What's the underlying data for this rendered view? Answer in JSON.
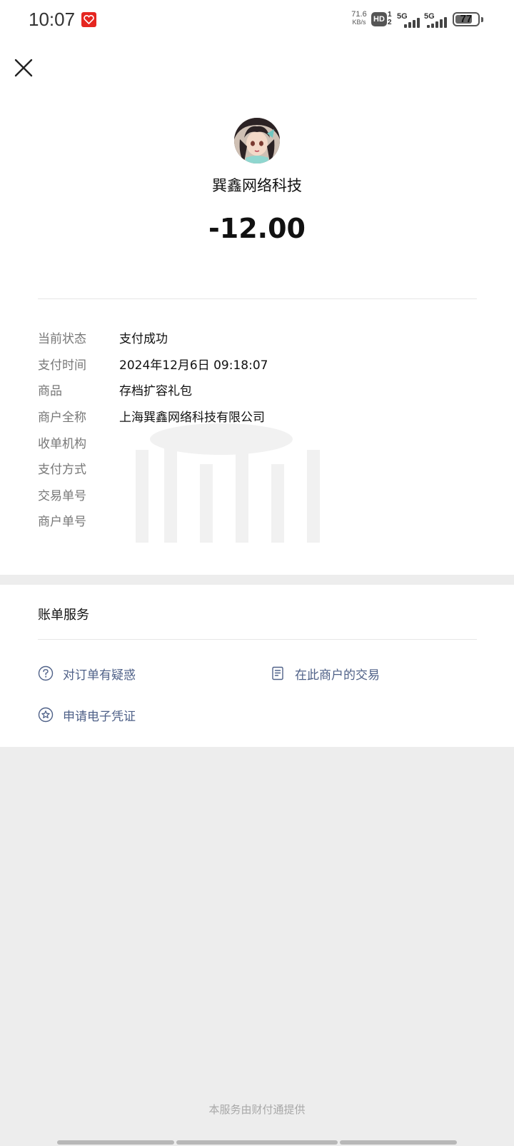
{
  "status_bar": {
    "time": "10:07",
    "net_speed_value": "71.6",
    "net_speed_unit": "KB/s",
    "hd_label": "HD",
    "hd_sup": "1",
    "hd_sub": "2",
    "signal1_label": "5G",
    "signal2_label": "5G",
    "battery": "77",
    "battery_level": 0.77
  },
  "header": {
    "close_icon": "close-icon"
  },
  "payee": {
    "avatar": "avatar-anime-girl",
    "name": "巽鑫网络科技",
    "amount": "-12.00"
  },
  "details": [
    {
      "key": "当前状态",
      "value": "支付成功"
    },
    {
      "key": "支付时间",
      "value": "2024年12月6日 09:18:07"
    },
    {
      "key": "商品",
      "value": "存档扩容礼包"
    },
    {
      "key": "商户全称",
      "value": "上海巽鑫网络科技有限公司"
    },
    {
      "key": "收单机构",
      "value": ""
    },
    {
      "key": "支付方式",
      "value": ""
    },
    {
      "key": "交易单号",
      "value": ""
    },
    {
      "key": "商户单号",
      "value": ""
    }
  ],
  "services": {
    "title": "账单服务",
    "items": [
      {
        "label": "对订单有疑惑",
        "icon": "question-circle-icon"
      },
      {
        "label": "在此商户的交易",
        "icon": "document-icon"
      },
      {
        "label": "申请电子凭证",
        "icon": "star-badge-icon"
      }
    ]
  },
  "footer": "本服务由财付通提供",
  "colors": {
    "page_bg": "#ededed",
    "card_bg": "#ffffff",
    "link": "#4f6188",
    "muted": "#777777"
  }
}
